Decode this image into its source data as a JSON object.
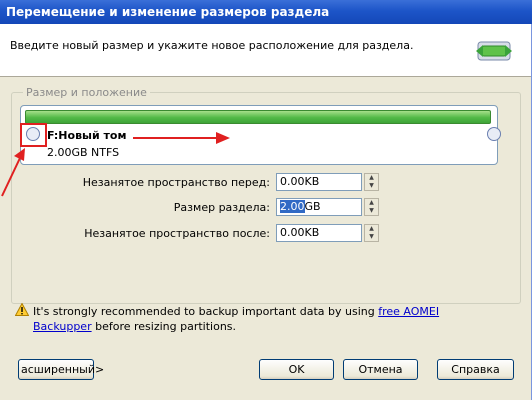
{
  "window": {
    "title": "Перемещение и изменение размеров раздела"
  },
  "banner": {
    "description": "Введите новый размер и укажите новое расположение для раздела.",
    "icon": "resize-arrows-icon"
  },
  "group": {
    "legend": "Размер и положение"
  },
  "partition": {
    "name": "F:Новый том",
    "info": "2.00GB NTFS",
    "fill_fraction": 1.0
  },
  "fields": {
    "space_before_label": "Незанятое пространство перед:",
    "space_before_value": "0.00KB",
    "size_label": "Размер раздела:",
    "size_value_selected": "2.00",
    "size_value_unit": "GB",
    "space_after_label": "Незанятое пространство после:",
    "space_after_value": "0.00KB"
  },
  "warning": {
    "text_before": "It's strongly recommended to backup important data by using ",
    "link": "free AOMEI Backupper",
    "text_after": " before resizing partitions."
  },
  "buttons": {
    "advanced": "асширенный>",
    "ok": "OK",
    "cancel": "Отмена",
    "help": "Справка"
  },
  "colors": {
    "annotation": "#e02020",
    "partition_bar": "#52b947",
    "titlebar": "#1d55c8"
  }
}
